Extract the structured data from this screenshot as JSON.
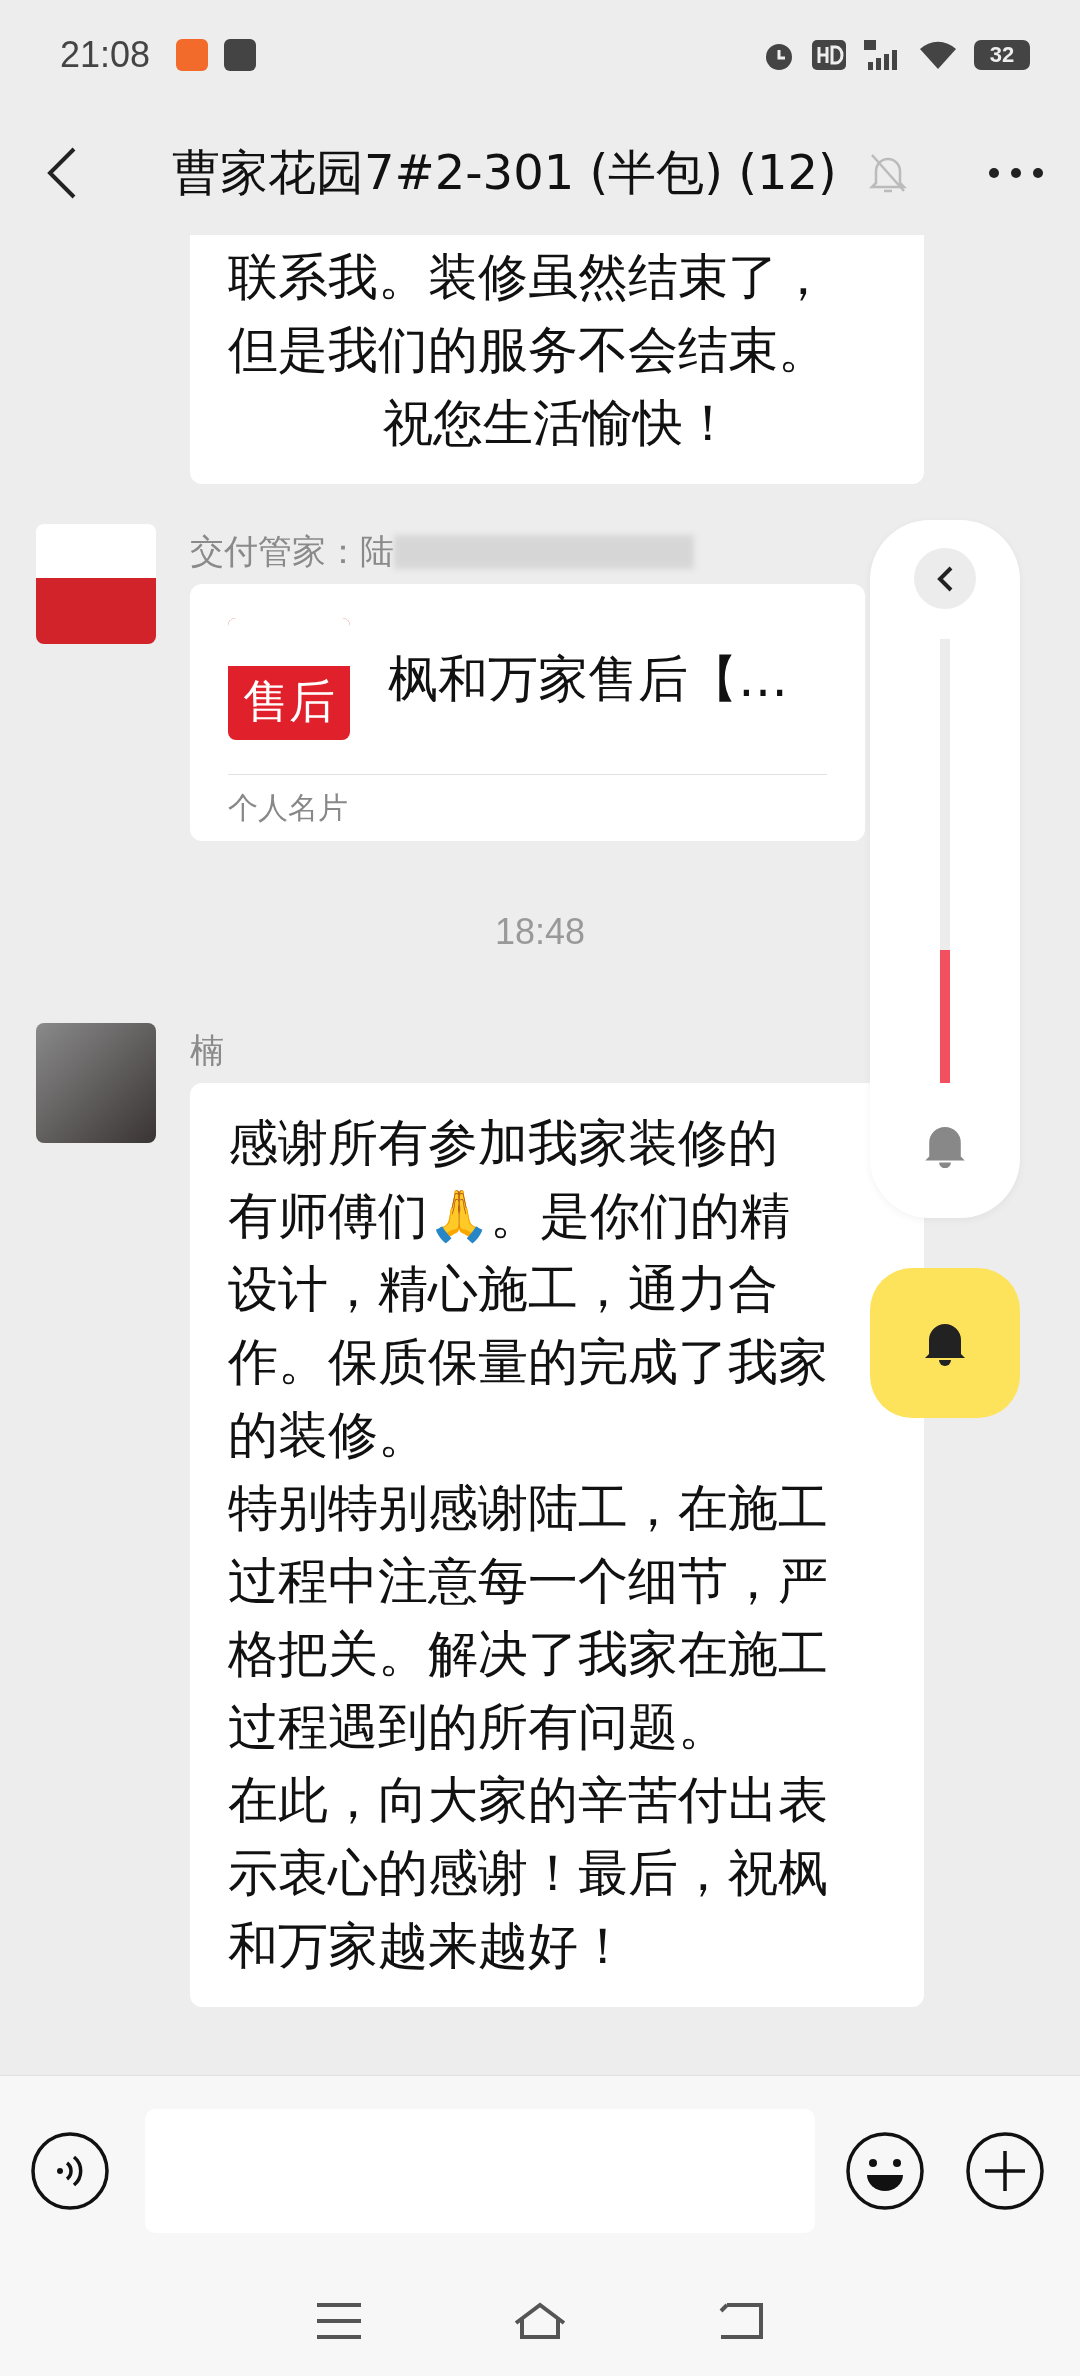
{
  "status_bar": {
    "time": "21:08",
    "battery": "32"
  },
  "header": {
    "title": "曹家花园7#2-301 (半包) (12)",
    "muted": true
  },
  "messages": [
    {
      "kind": "text",
      "lines": [
        "联系我。装修虽然结束了，",
        "但是我们的服务不会结束。",
        "祝您生活愉快！"
      ]
    },
    {
      "kind": "card",
      "sender": "交付管家：陆",
      "title": "枫和万家售后【…",
      "logo_text": "售后",
      "footer": "个人名片"
    },
    {
      "kind": "time",
      "text": "18:48"
    },
    {
      "kind": "text",
      "sender": "楠",
      "lines": [
        "感谢所有参加我家装修的",
        "有师傅们🙏。是你们的精",
        "设计，精心施工，通力合",
        "作。保质保量的完成了我家",
        "的装修。",
        "特别特别感谢陆工，在施工",
        "过程中注意每一个细节，严",
        "格把关。解决了我家在施工",
        "过程遇到的所有问题。",
        "在此，向大家的辛苦付出表",
        "示衷心的感谢！最后，祝枫",
        "和万家越来越好！"
      ]
    }
  ],
  "float_panel": {
    "level": 0.3
  }
}
